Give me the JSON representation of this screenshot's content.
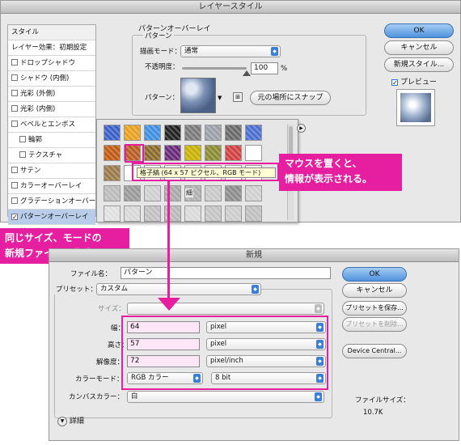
{
  "layer_style": {
    "title": "レイヤースタイル",
    "styles_header": "スタイル",
    "blend_options": "レイヤー効果：初期設定",
    "effects": [
      {
        "label": "ドロップシャドウ",
        "checked": false,
        "indent": false
      },
      {
        "label": "シャドウ (内側)",
        "checked": false,
        "indent": false
      },
      {
        "label": "光彩 (外側)",
        "checked": false,
        "indent": false
      },
      {
        "label": "光彩 (内側)",
        "checked": false,
        "indent": false
      },
      {
        "label": "ベベルとエンボス",
        "checked": false,
        "indent": false
      },
      {
        "label": "輪郭",
        "checked": false,
        "indent": true
      },
      {
        "label": "テクスチャ",
        "checked": false,
        "indent": true
      },
      {
        "label": "サテン",
        "checked": false,
        "indent": false
      },
      {
        "label": "カラーオーバーレイ",
        "checked": false,
        "indent": false
      },
      {
        "label": "グラデーションオーバーレ",
        "checked": false,
        "indent": false
      },
      {
        "label": "パターンオーバーレイ",
        "checked": true,
        "indent": false
      },
      {
        "label": "境界線",
        "checked": false,
        "indent": false
      }
    ],
    "section_title": "パターンオーバーレイ",
    "group_title": "パターン",
    "blend_mode_label": "描画モード：",
    "blend_mode_value": "通常",
    "opacity_label": "不透明度：",
    "opacity_value": "100",
    "opacity_unit": "%",
    "opacity_level": 1.0,
    "pattern_label": "パターン：",
    "snap_button": "元の場所にスナップ",
    "ok": "OK",
    "cancel": "キャンセル",
    "new_style": "新規スタイル...",
    "preview_label": "プレビュー",
    "preview_checked": true,
    "tooltip": "格子縞 (64 x 57 ピクセル、RGB モード)"
  },
  "pattern_swatches": [
    [
      "#3a5fc7",
      "#e8a020",
      "#3d8fe0",
      "#222222",
      "#7a7a7a",
      "#9aa0a8",
      "#6a6a6a",
      "#4b6fd0"
    ],
    [
      "#c05a10",
      "#b85c22",
      "#8a6a2a",
      "#6a2a7a",
      "#c8b000",
      "#8a8a30",
      "#d04040",
      "#ffffff"
    ],
    [
      "#9a7a4a",
      "#ffffff",
      "#ffffff",
      "#ffffff",
      "#ffffff",
      "#ffffff",
      "#ffffff",
      "#ffffff"
    ],
    [
      "#bbbbbb",
      "#999999",
      "#cfcfcf",
      "#a8a8a8",
      "#b0b0b0",
      "#c8c8c8",
      "#8c8c8c",
      "#d0d0d0"
    ],
    [
      "#e0e0e0",
      "#d8d8d8",
      "#c0c0c0",
      "#b8b8b8",
      "#dadada",
      "#c4c4c4",
      "#cccccc",
      "#bfbfbf"
    ]
  ],
  "pattern_partial_label": "細",
  "callout_top": {
    "line1": "マウスを置くと、",
    "line2": "情報が表示される。"
  },
  "callout_left": {
    "line1": "同じサイズ、モードの",
    "line2": "新規ファイルを作成"
  },
  "new_dialog": {
    "title": "新規",
    "name_label": "ファイル名：",
    "name_value": "パターン",
    "preset_label": "プリセット：",
    "preset_value": "カスタム",
    "size_label": "サイズ：",
    "width_label": "幅：",
    "width_value": "64",
    "width_unit": "pixel",
    "height_label": "高さ：",
    "height_value": "57",
    "height_unit": "pixel",
    "resolution_label": "解像度：",
    "resolution_value": "72",
    "resolution_unit": "pixel/inch",
    "color_mode_label": "カラーモード：",
    "color_mode_value": "RGB カラー",
    "bit_value": "8 bit",
    "canvas_label": "カンバスカラー：",
    "canvas_value": "白",
    "advanced_label": "詳細",
    "ok": "OK",
    "cancel": "キャンセル",
    "save_preset": "プリセットを保存...",
    "delete_preset": "プリセットを削除...",
    "device_central": "Device Central...",
    "file_size_label": "ファイルサイズ：",
    "file_size_value": "10.7K"
  },
  "accent_magenta": "#e61ea0"
}
